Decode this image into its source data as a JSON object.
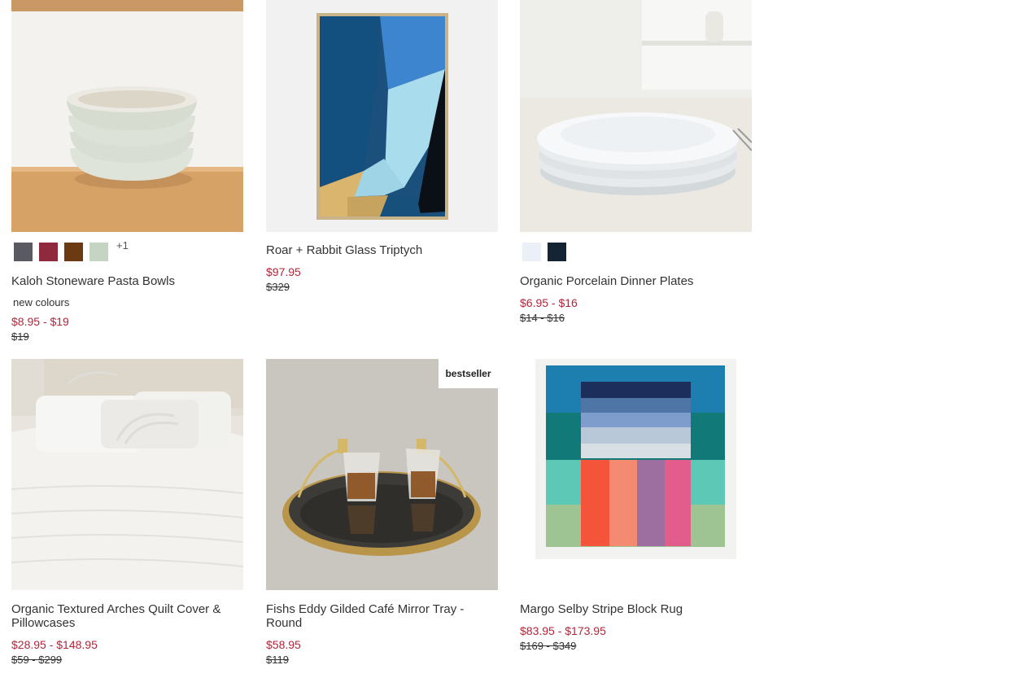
{
  "products": [
    {
      "title": "Kaloh Stoneware Pasta Bowls",
      "sale_price": "$8.95 - $19",
      "original_price": "$19",
      "note": "new colours",
      "swatches": [
        "#5a5a62",
        "#8f2a3e",
        "#6b3a12",
        "#c6d4c4"
      ],
      "more_swatches": "+1"
    },
    {
      "title": "Roar + Rabbit Glass Triptych",
      "sale_price": "$97.95",
      "original_price": "$329"
    },
    {
      "title": "Organic Porcelain Dinner Plates",
      "sale_price": "$6.95 - $16",
      "original_price": "$14 - $16",
      "swatches": [
        "#eaf0f6",
        "#142432"
      ]
    },
    {
      "title": "Organic Textured Arches Quilt Cover & Pillowcases",
      "sale_price": "$28.95 - $148.95",
      "original_price": "$59 - $299"
    },
    {
      "title": "Fishs Eddy Gilded Café Mirror Tray - Round",
      "sale_price": "$58.95",
      "original_price": "$119",
      "badge": "bestseller"
    },
    {
      "title": "Margo Selby Stripe Block Rug",
      "sale_price": "$83.95 - $173.95",
      "original_price": "$169 - $349"
    }
  ]
}
